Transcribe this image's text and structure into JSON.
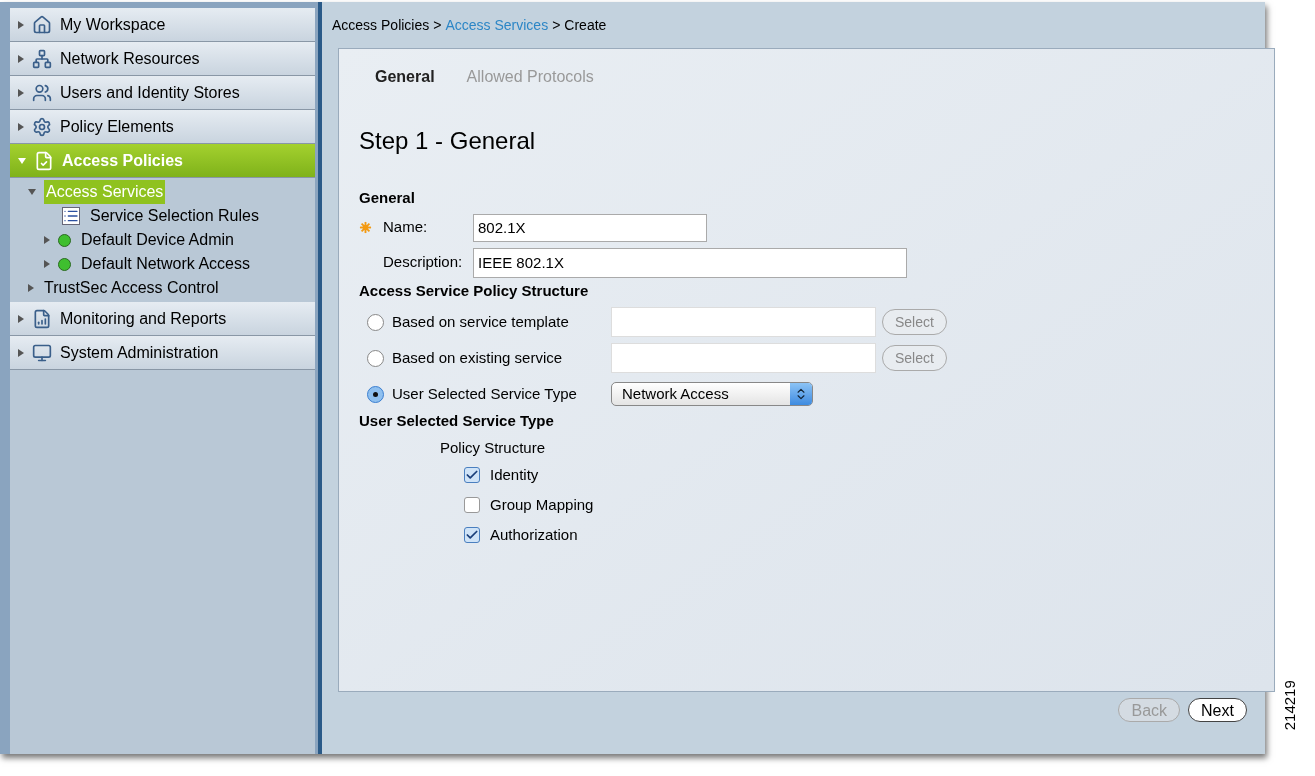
{
  "sidebar": {
    "drawers": [
      {
        "label": "My Workspace",
        "kind": "house",
        "expanded": false,
        "selected": false
      },
      {
        "label": "Network Resources",
        "kind": "network",
        "expanded": false,
        "selected": false
      },
      {
        "label": "Users and Identity Stores",
        "kind": "users",
        "expanded": false,
        "selected": false
      },
      {
        "label": "Policy Elements",
        "kind": "gear",
        "expanded": false,
        "selected": false
      },
      {
        "label": "Access Policies",
        "kind": "policy",
        "expanded": true,
        "selected": true,
        "children": [
          {
            "label": "Access Services",
            "kind": "folder",
            "expanded": true,
            "selected": true,
            "children": [
              {
                "label": "Service Selection Rules",
                "kind": "rules",
                "selected": false
              },
              {
                "label": "Default Device Admin",
                "kind": "service",
                "expanded": false,
                "selected": false,
                "color": "#3fbf2f"
              },
              {
                "label": "Default Network Access",
                "kind": "service",
                "expanded": false,
                "selected": false,
                "color": "#3fbf2f"
              }
            ]
          },
          {
            "label": "TrustSec Access Control",
            "kind": "folder",
            "expanded": false,
            "selected": false
          }
        ]
      },
      {
        "label": "Monitoring and Reports",
        "kind": "report",
        "expanded": false,
        "selected": false
      },
      {
        "label": "System Administration",
        "kind": "monitor",
        "expanded": false,
        "selected": false
      }
    ]
  },
  "breadcrumb": [
    {
      "label": "Access Policies",
      "link": false
    },
    {
      "label": "Access Services",
      "link": true
    },
    {
      "label": "Create",
      "link": false
    }
  ],
  "breadcrumb_separator": ">",
  "tabs": [
    {
      "label": "General",
      "selected": true
    },
    {
      "label": "Allowed Protocols",
      "selected": false
    }
  ],
  "step_title": "Step 1 - General",
  "general": {
    "heading": "General",
    "name": {
      "label": "Name:",
      "required": true,
      "value": "802.1X"
    },
    "description": {
      "label": "Description:",
      "value": "IEEE 802.1X"
    }
  },
  "policy_structure": {
    "heading": "Access Service Policy Structure",
    "options": [
      {
        "label": "Based on service template",
        "kind": "lookup",
        "selected": false,
        "button": "Select"
      },
      {
        "label": "Based on existing service",
        "kind": "lookup",
        "selected": false,
        "button": "Select"
      },
      {
        "label": "User Selected Service Type",
        "kind": "dropdown",
        "selected": true,
        "value": "Network Access"
      }
    ]
  },
  "service_type": {
    "heading": "User Selected Service Type",
    "subheading": "Policy Structure",
    "items": [
      {
        "label": "Identity",
        "checked": true
      },
      {
        "label": "Group Mapping",
        "checked": false
      },
      {
        "label": "Authorization",
        "checked": true
      }
    ]
  },
  "footer": {
    "buttons": [
      {
        "label": "Back",
        "disabled": true
      },
      {
        "label": "Next",
        "disabled": false
      }
    ]
  },
  "figure_id": "214219"
}
